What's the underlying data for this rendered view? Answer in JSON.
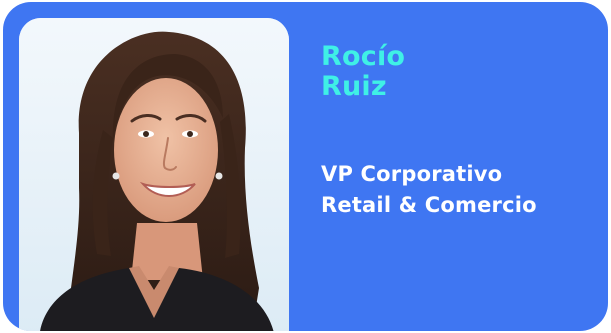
{
  "profile": {
    "first_name": "Rocío",
    "last_name": "Ruiz",
    "title_line1": "VP Corporativo",
    "title_line2": "Retail & Comercio"
  },
  "colors": {
    "card_background": "#3f76f2",
    "name_accent": "#3ff0e6",
    "title_text": "#ffffff"
  }
}
